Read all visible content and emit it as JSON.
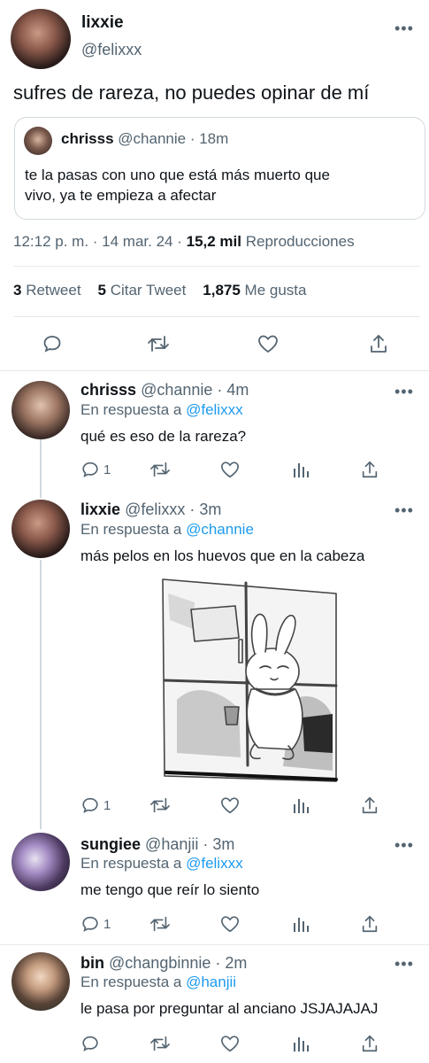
{
  "main_tweet": {
    "display_name": "lixxie",
    "handle": "@felixxx",
    "text": "sufres de rareza, no puedes opinar de mí",
    "quoted": {
      "display_name": "chrisss",
      "handle": "@channie",
      "time": "· 18m",
      "text_line1": "te la pasas con uno que está más muerto que",
      "text_line2": "vivo, ya te empieza a afectar"
    },
    "timestamp": "12:12 p. m. · 14 mar. 24 ·",
    "views_count": "15,2 mil",
    "views_label": "Reproducciones",
    "retweets_count": "3",
    "retweets_label": "Retweet",
    "quotes_count": "5",
    "quotes_label": "Citar Tweet",
    "likes_count": "1,875",
    "likes_label": "Me gusta"
  },
  "replies": [
    {
      "display_name": "chrisss",
      "handle": "@channie",
      "time": "· 4m",
      "reply_prefix": "En respuesta a",
      "reply_to": "@felixxx",
      "text": "qué es eso de la rareza?",
      "reply_count": "1"
    },
    {
      "display_name": "lixxie",
      "handle": "@felixxx",
      "time": "· 3m",
      "reply_prefix": "En respuesta a",
      "reply_to": "@channie",
      "text": "más pelos en los huevos que en la cabeza",
      "reply_count": "1"
    },
    {
      "display_name": "sungiee",
      "handle": "@hanjii",
      "time": "· 3m",
      "reply_prefix": "En respuesta a",
      "reply_to": "@felixxx",
      "text": "me tengo que reír lo siento",
      "reply_count": "1"
    },
    {
      "display_name": "bin",
      "handle": "@changbinnie",
      "time": "· 2m",
      "reply_prefix": "En respuesta a",
      "reply_to": "@hanjii",
      "text": "le pasa por preguntar al anciano JSJAJAJAJ",
      "reply_count": ""
    }
  ],
  "more_glyph": "•••",
  "colors": {
    "accent": "#1d9bf0",
    "text": "#0f1419",
    "secondary": "#536471",
    "divider": "#e6e9ec"
  },
  "icons": [
    "more-icon",
    "reply-icon",
    "retweet-icon",
    "like-icon",
    "share-icon",
    "views-icon"
  ]
}
